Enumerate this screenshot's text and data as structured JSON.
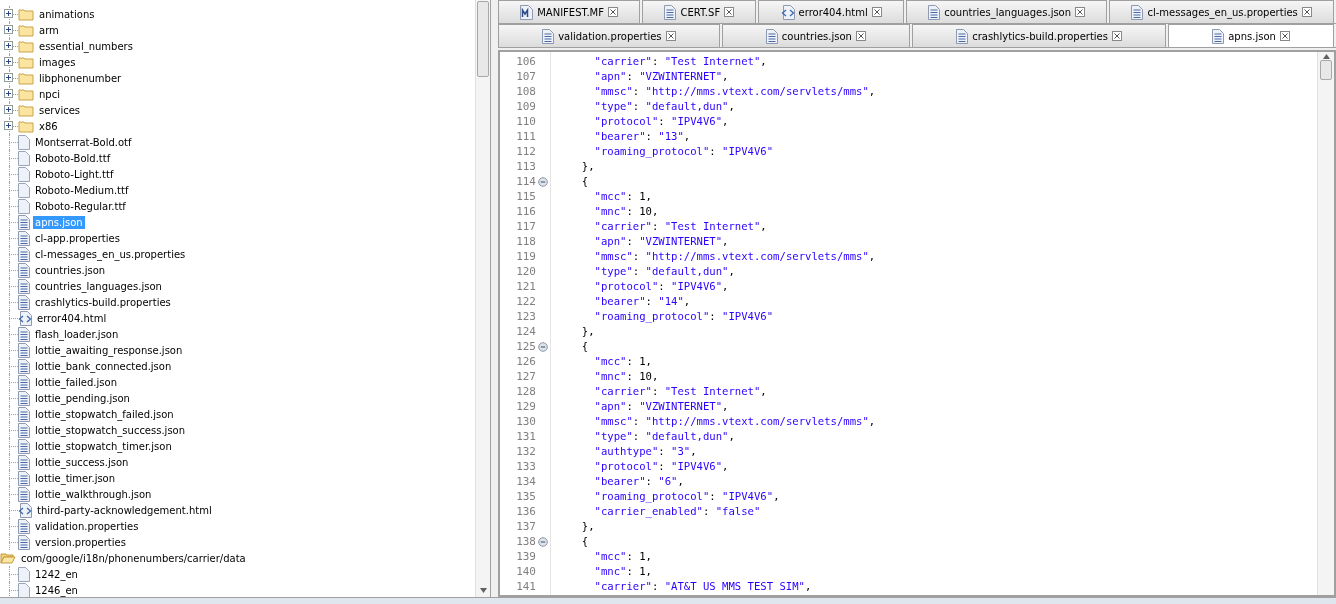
{
  "tree": [
    {
      "children": [
        {
          "label": "animations",
          "kind": "folder",
          "expanded": false,
          "selected": false
        },
        {
          "label": "arm",
          "kind": "folder",
          "expanded": false,
          "selected": false
        },
        {
          "label": "essential_numbers",
          "kind": "folder",
          "expanded": false,
          "selected": false
        },
        {
          "label": "images",
          "kind": "folder",
          "expanded": false,
          "selected": false
        },
        {
          "label": "libphonenumber",
          "kind": "folder",
          "expanded": false,
          "selected": false
        },
        {
          "label": "npci",
          "kind": "folder",
          "expanded": false,
          "selected": false
        },
        {
          "label": "services",
          "kind": "folder",
          "expanded": false,
          "selected": false
        },
        {
          "label": "x86",
          "kind": "folder",
          "expanded": false,
          "selected": false
        },
        {
          "label": "Montserrat-Bold.otf",
          "kind": "file",
          "selected": false
        },
        {
          "label": "Roboto-Bold.ttf",
          "kind": "file",
          "selected": false
        },
        {
          "label": "Roboto-Light.ttf",
          "kind": "file",
          "selected": false
        },
        {
          "label": "Roboto-Medium.ttf",
          "kind": "file",
          "selected": false
        },
        {
          "label": "Roboto-Regular.ttf",
          "kind": "file",
          "selected": false
        },
        {
          "label": "apns.json",
          "kind": "text",
          "selected": true
        },
        {
          "label": "cl-app.properties",
          "kind": "text",
          "selected": false
        },
        {
          "label": "cl-messages_en_us.properties",
          "kind": "text",
          "selected": false
        },
        {
          "label": "countries.json",
          "kind": "text",
          "selected": false
        },
        {
          "label": "countries_languages.json",
          "kind": "text",
          "selected": false
        },
        {
          "label": "crashlytics-build.properties",
          "kind": "text",
          "selected": false
        },
        {
          "label": "error404.html",
          "kind": "html",
          "selected": false
        },
        {
          "label": "flash_loader.json",
          "kind": "text",
          "selected": false
        },
        {
          "label": "lottie_awaiting_response.json",
          "kind": "text",
          "selected": false
        },
        {
          "label": "lottie_bank_connected.json",
          "kind": "text",
          "selected": false
        },
        {
          "label": "lottie_failed.json",
          "kind": "text",
          "selected": false
        },
        {
          "label": "lottie_pending.json",
          "kind": "text",
          "selected": false
        },
        {
          "label": "lottie_stopwatch_failed.json",
          "kind": "text",
          "selected": false
        },
        {
          "label": "lottie_stopwatch_success.json",
          "kind": "text",
          "selected": false
        },
        {
          "label": "lottie_stopwatch_timer.json",
          "kind": "text",
          "selected": false
        },
        {
          "label": "lottie_success.json",
          "kind": "text",
          "selected": false
        },
        {
          "label": "lottie_timer.json",
          "kind": "text",
          "selected": false
        },
        {
          "label": "lottie_walkthrough.json",
          "kind": "text",
          "selected": false
        },
        {
          "label": "third-party-acknowledgement.html",
          "kind": "html",
          "selected": false
        },
        {
          "label": "validation.properties",
          "kind": "text",
          "selected": false
        },
        {
          "label": "version.properties",
          "kind": "text",
          "selected": false
        }
      ]
    },
    {
      "label": "com/google/i18n/phonenumbers/carrier/data",
      "kind": "folder",
      "expanded": true,
      "selected": false,
      "children": [
        {
          "label": "1242_en",
          "kind": "file",
          "selected": false
        },
        {
          "label": "1246_en",
          "kind": "file",
          "selected": false
        }
      ]
    }
  ],
  "tab_rows": [
    [
      {
        "label": "MANIFEST.MF",
        "kind": "manifest",
        "selected": false
      },
      {
        "label": "CERT.SF",
        "kind": "text",
        "selected": false
      },
      {
        "label": "error404.html",
        "kind": "html",
        "selected": false
      },
      {
        "label": "countries_languages.json",
        "kind": "text",
        "selected": false
      },
      {
        "label": "cl-messages_en_us.properties",
        "kind": "text",
        "selected": false
      }
    ],
    [
      {
        "label": "validation.properties",
        "kind": "text",
        "selected": false
      },
      {
        "label": "countries.json",
        "kind": "text",
        "selected": false
      },
      {
        "label": "crashlytics-build.properties",
        "kind": "text",
        "selected": false
      },
      {
        "label": "apns.json",
        "kind": "text",
        "selected": true
      }
    ]
  ],
  "code_lines": [
    {
      "number": "106",
      "fold": false,
      "text": "    \"carrier\": \"Test Internet\","
    },
    {
      "number": "107",
      "fold": false,
      "text": "    \"apn\": \"VZWINTERNET\","
    },
    {
      "number": "108",
      "fold": false,
      "text": "    \"mmsc\": \"http://mms.vtext.com/servlets/mms\","
    },
    {
      "number": "109",
      "fold": false,
      "text": "    \"type\": \"default,dun\","
    },
    {
      "number": "110",
      "fold": false,
      "text": "    \"protocol\": \"IPV4V6\","
    },
    {
      "number": "111",
      "fold": false,
      "text": "    \"bearer\": \"13\","
    },
    {
      "number": "112",
      "fold": false,
      "text": "    \"roaming_protocol\": \"IPV4V6\""
    },
    {
      "number": "113",
      "fold": false,
      "text": "  },"
    },
    {
      "number": "114",
      "fold": true,
      "text": "  {"
    },
    {
      "number": "115",
      "fold": false,
      "text": "    \"mcc\": 1,"
    },
    {
      "number": "116",
      "fold": false,
      "text": "    \"mnc\": 10,"
    },
    {
      "number": "117",
      "fold": false,
      "text": "    \"carrier\": \"Test Internet\","
    },
    {
      "number": "118",
      "fold": false,
      "text": "    \"apn\": \"VZWINTERNET\","
    },
    {
      "number": "119",
      "fold": false,
      "text": "    \"mmsc\": \"http://mms.vtext.com/servlets/mms\","
    },
    {
      "number": "120",
      "fold": false,
      "text": "    \"type\": \"default,dun\","
    },
    {
      "number": "121",
      "fold": false,
      "text": "    \"protocol\": \"IPV4V6\","
    },
    {
      "number": "122",
      "fold": false,
      "text": "    \"bearer\": \"14\","
    },
    {
      "number": "123",
      "fold": false,
      "text": "    \"roaming_protocol\": \"IPV4V6\""
    },
    {
      "number": "124",
      "fold": false,
      "text": "  },"
    },
    {
      "number": "125",
      "fold": true,
      "text": "  {"
    },
    {
      "number": "126",
      "fold": false,
      "text": "    \"mcc\": 1,"
    },
    {
      "number": "127",
      "fold": false,
      "text": "    \"mnc\": 10,"
    },
    {
      "number": "128",
      "fold": false,
      "text": "    \"carrier\": \"Test Internet\","
    },
    {
      "number": "129",
      "fold": false,
      "text": "    \"apn\": \"VZWINTERNET\","
    },
    {
      "number": "130",
      "fold": false,
      "text": "    \"mmsc\": \"http://mms.vtext.com/servlets/mms\","
    },
    {
      "number": "131",
      "fold": false,
      "text": "    \"type\": \"default,dun\","
    },
    {
      "number": "132",
      "fold": false,
      "text": "    \"authtype\": \"3\","
    },
    {
      "number": "133",
      "fold": false,
      "text": "    \"protocol\": \"IPV4V6\","
    },
    {
      "number": "134",
      "fold": false,
      "text": "    \"bearer\": \"6\","
    },
    {
      "number": "135",
      "fold": false,
      "text": "    \"roaming_protocol\": \"IPV4V6\","
    },
    {
      "number": "136",
      "fold": false,
      "text": "    \"carrier_enabled\": \"false\""
    },
    {
      "number": "137",
      "fold": false,
      "text": "  },"
    },
    {
      "number": "138",
      "fold": true,
      "text": "  {"
    },
    {
      "number": "139",
      "fold": false,
      "text": "    \"mcc\": 1,"
    },
    {
      "number": "140",
      "fold": false,
      "text": "    \"mnc\": 1,"
    },
    {
      "number": "141",
      "fold": false,
      "text": "    \"carrier\": \"AT&T US MMS TEST SIM\","
    }
  ]
}
